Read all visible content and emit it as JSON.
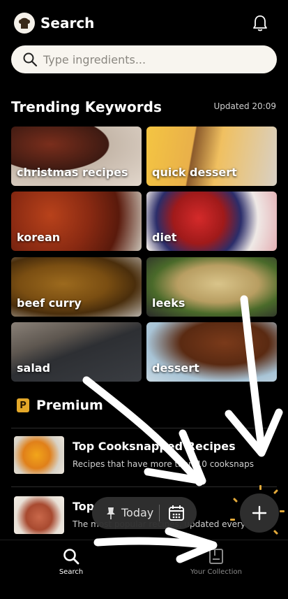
{
  "header": {
    "title": "Search",
    "logo_icon": "chef-hat-icon",
    "notification_icon": "bell-icon"
  },
  "search": {
    "placeholder": "Type ingredients...",
    "icon": "search-icon"
  },
  "trending": {
    "title": "Trending Keywords",
    "updated": "Updated 20:09",
    "keywords": [
      {
        "label": "christmas recipes"
      },
      {
        "label": "quick dessert"
      },
      {
        "label": "korean"
      },
      {
        "label": "diet"
      },
      {
        "label": "beef curry"
      },
      {
        "label": "leeks"
      },
      {
        "label": "salad"
      },
      {
        "label": "dessert"
      }
    ]
  },
  "premium": {
    "badge": "P",
    "title": "Premium",
    "accent_color": "#e4a829",
    "cards": [
      {
        "title": "Top Cooksnapped Recipes",
        "subtitle": "Recipes that have more than 10 cooksnaps"
      },
      {
        "title": "Top",
        "subtitle": "The most popular recipes, updated every day"
      }
    ]
  },
  "floating": {
    "today_label": "Today",
    "pin_icon": "pin-icon",
    "calendar_icon": "calendar-icon",
    "fab_icon": "plus-icon"
  },
  "nav": {
    "items": [
      {
        "label": "Search",
        "icon": "search-icon",
        "active": true
      },
      {
        "label": "Your Collection",
        "icon": "collection-icon",
        "active": false
      }
    ]
  },
  "annotation": {
    "color": "#ffffff",
    "description_icon": "hand-drawn-arrow"
  }
}
